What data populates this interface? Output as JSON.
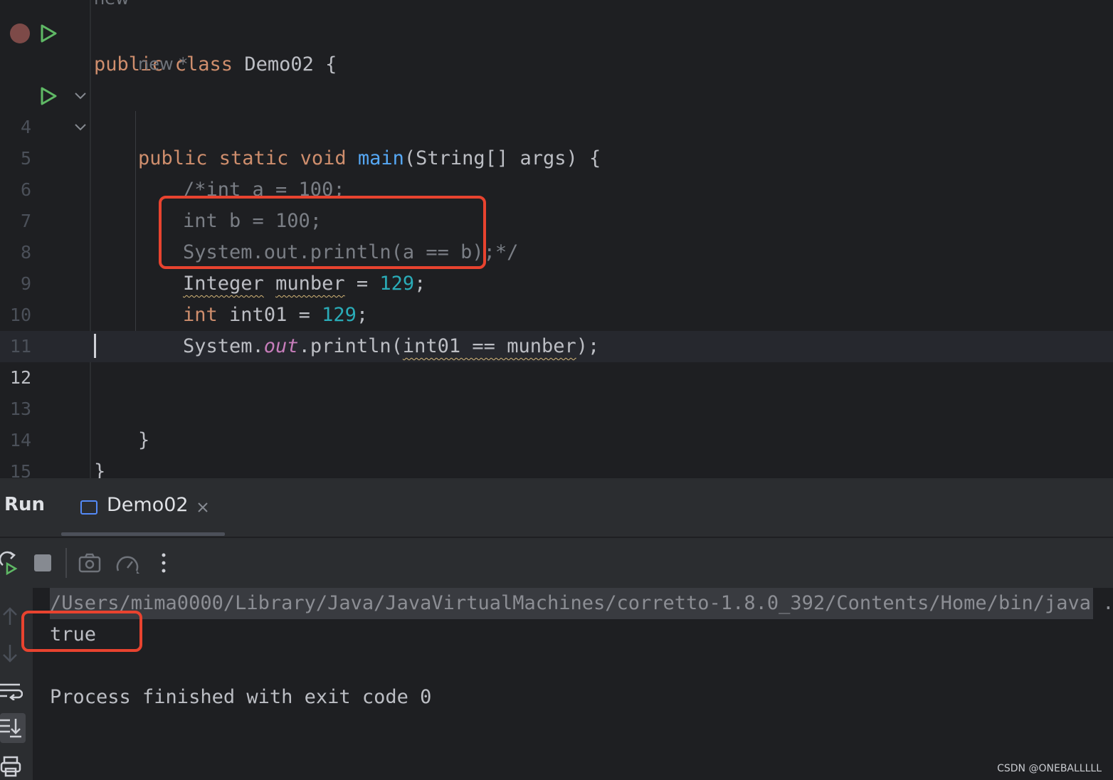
{
  "editor": {
    "hints": {
      "top": "new *",
      "method": "new *"
    },
    "lines": [
      {
        "num": "",
        "parts": [
          [
            "kw",
            "public class "
          ],
          [
            "",
            "Demo02 {"
          ]
        ]
      },
      {
        "num": "4",
        "parts": [
          [
            "kw",
            "public static void "
          ],
          [
            "fn",
            "main"
          ],
          [
            "",
            "(String[] args) {"
          ]
        ]
      },
      {
        "num": "5",
        "comment": "/*int a = 100;"
      },
      {
        "num": "6",
        "comment": "int b = 100;"
      },
      {
        "num": "7",
        "comment": "System.out.println(a == b);*/"
      },
      {
        "num": "8"
      },
      {
        "num": "9"
      },
      {
        "num": "10"
      },
      {
        "num": "11"
      },
      {
        "num": "12"
      },
      {
        "num": "13",
        "text": "}"
      },
      {
        "num": "14",
        "text": "}"
      },
      {
        "num": "15"
      }
    ],
    "line8": {
      "type": "Integer",
      "var": "munber",
      "eq": " = ",
      "val": "129",
      "end": ";"
    },
    "line9": {
      "kw": "int",
      "var": "int01",
      "eq": " = ",
      "val": "129",
      "end": ";"
    },
    "line10": {
      "a": "System.",
      "field": "out",
      "b": ".println(",
      "expr": "int01 == munber",
      "c": ");"
    }
  },
  "run_panel": {
    "title": "Run",
    "tab_label": "Demo02",
    "command": "/Users/mima0000/Library/Java/JavaVirtualMachines/corretto-1.8.0_392/Contents/Home/bin/java ...",
    "output": "true",
    "exit_message": "Process finished with exit code 0"
  },
  "watermark": "CSDN @ONEBALLLLL",
  "colors": {
    "keyword": "#cf8e6d",
    "function": "#56a8f5",
    "number": "#2aacb8",
    "highlight_box": "#e8432f"
  }
}
